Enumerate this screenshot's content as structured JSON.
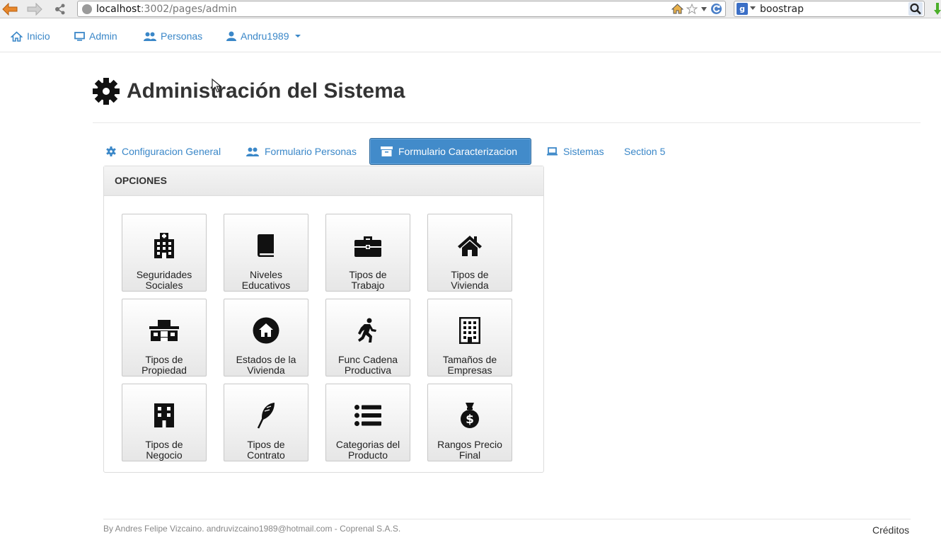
{
  "browser": {
    "url_host": "localhost",
    "url_path": ":3002/pages/admin",
    "search_value": "boostrap"
  },
  "navbar": {
    "items": [
      {
        "label": "Inicio",
        "icon": "home-icon"
      },
      {
        "label": "Admin",
        "icon": "monitor-icon"
      },
      {
        "label": "Personas",
        "icon": "users-icon"
      },
      {
        "label": "Andru1989",
        "icon": "user-icon"
      }
    ]
  },
  "header": {
    "title": "Administración del Sistema",
    "icon": "gear-icon"
  },
  "tabs": [
    {
      "label": "Configuracion General",
      "icon": "gear-icon",
      "active": false
    },
    {
      "label": "Formulario Personas",
      "icon": "users-icon",
      "active": false
    },
    {
      "label": "Formulario Caracterizacion",
      "icon": "archive-icon",
      "active": true
    },
    {
      "label": "Sistemas",
      "icon": "laptop-icon",
      "active": false
    },
    {
      "label": "Section 5",
      "icon": "",
      "active": false
    }
  ],
  "panel": {
    "heading": "OPCIONES",
    "tiles": [
      {
        "line1": "Seguridades",
        "line2": "Sociales",
        "icon": "hospital-icon"
      },
      {
        "line1": "Niveles",
        "line2": "Educativos",
        "icon": "book-icon"
      },
      {
        "line1": "Tipos de",
        "line2": "Trabajo",
        "icon": "briefcase-icon"
      },
      {
        "line1": "Tipos de",
        "line2": "Vivienda",
        "icon": "house-icon"
      },
      {
        "line1": "Tipos de",
        "line2": "Propiedad",
        "icon": "building-store-icon"
      },
      {
        "line1": "Estados de la",
        "line2": "Vivienda",
        "icon": "home-circle-icon"
      },
      {
        "line1": "Func Cadena",
        "line2": "Productiva",
        "icon": "running-man-icon"
      },
      {
        "line1": "Tamaños de",
        "line2": "Empresas",
        "icon": "office-building-icon"
      },
      {
        "line1": "Tipos de",
        "line2": "Negocio",
        "icon": "tower-icon"
      },
      {
        "line1": "Tipos de",
        "line2": "Contrato",
        "icon": "feather-icon"
      },
      {
        "line1": "Categorias del",
        "line2": "Producto",
        "icon": "list-icon"
      },
      {
        "line1": "Rangos Precio",
        "line2": "Final",
        "icon": "money-bag-icon"
      }
    ]
  },
  "footer": {
    "text": "By Andres Felipe Vizcaino. andruvizcaino1989@hotmail.com - Coprenal S.A.S.",
    "credits": "Créditos"
  }
}
